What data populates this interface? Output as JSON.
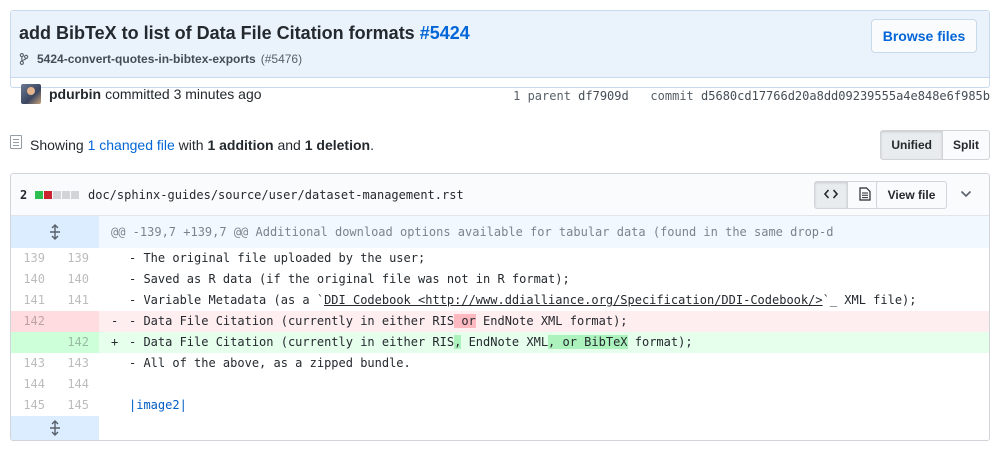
{
  "commit": {
    "title": "add BibTeX to list of Data File Citation formats",
    "pr_ref": "#5424",
    "branch": "5424-convert-quotes-in-bibtex-exports",
    "branch_pr": "(#5476)",
    "browse_label": "Browse files",
    "author": "pdurbin",
    "action": "committed 3 minutes ago",
    "parent_label": "1 parent",
    "parent_sha": "df7909d",
    "commit_label": "commit",
    "commit_sha": "d5680cd17766d20a8dd09239555a4e848e6f985b"
  },
  "summary": {
    "prefix": "Showing",
    "changed": "1 changed file",
    "with": "with",
    "additions": "1 addition",
    "and": "and",
    "deletions": "1 deletion",
    "suffix": "."
  },
  "view_toggle": {
    "unified": "Unified",
    "split": "Split",
    "active": "Unified"
  },
  "file": {
    "change_count": "2",
    "diffstat": [
      "add",
      "del",
      "neu",
      "neu",
      "neu"
    ],
    "path": "doc/sphinx-guides/source/user/dataset-management.rst",
    "view_file_label": "View file",
    "hunk_header": "@@ -139,7 +139,7 @@ Additional download options available for tabular data (found in the same drop-d",
    "lines": [
      {
        "type": "ctx",
        "old": "139",
        "new": "139",
        "text": "- The original file uploaded by the user;"
      },
      {
        "type": "ctx",
        "old": "140",
        "new": "140",
        "text": "- Saved as R data (if the original file was not in R format);"
      },
      {
        "type": "ctx",
        "old": "141",
        "new": "141",
        "pre": "- Variable Metadata (as a `",
        "link": "DDI Codebook <http://www.ddialliance.org/Specification/DDI-Codebook/>",
        "post": "`_ XML file);"
      },
      {
        "type": "del",
        "old": "142",
        "new": "",
        "marker": "-",
        "pre": "- Data File Citation (currently in either RIS",
        "hl": " or",
        "post": " EndNote XML format);"
      },
      {
        "type": "add",
        "old": "",
        "new": "142",
        "marker": "+",
        "pre": "- Data File Citation (currently in either RIS",
        "hl1": ",",
        "mid": " EndNote XML",
        "hl2": ", or BibTeX",
        "post": " format);"
      },
      {
        "type": "ctx",
        "old": "143",
        "new": "143",
        "text": "- All of the above, as a zipped bundle."
      },
      {
        "type": "ctx",
        "old": "144",
        "new": "144",
        "text": ""
      },
      {
        "type": "ctx",
        "old": "145",
        "new": "145",
        "text": "|image2|",
        "blue": true
      }
    ]
  },
  "colors": {
    "link": "#0366d6",
    "header_bg": "#eaf3fc",
    "del_bg": "#ffeef0",
    "add_bg": "#e6ffed",
    "hunk_bg": "#f1f8ff"
  }
}
